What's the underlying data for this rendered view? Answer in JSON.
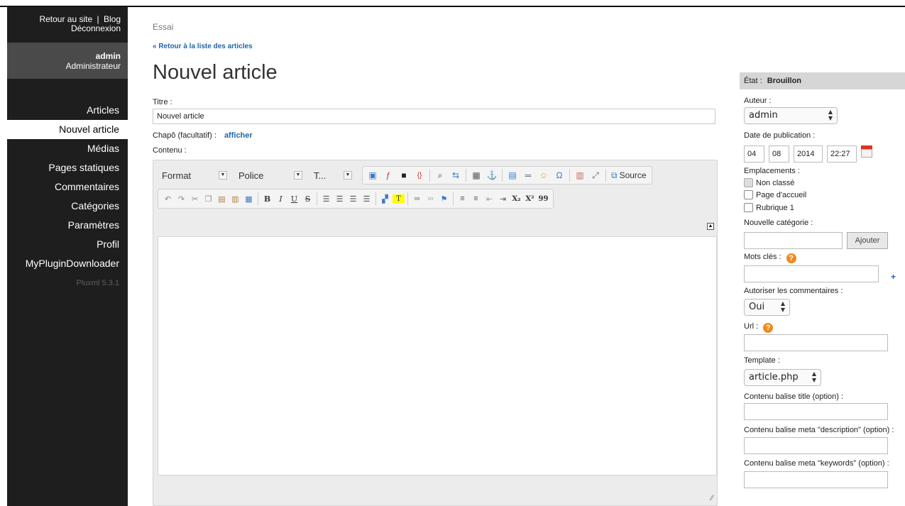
{
  "sidebar": {
    "top_links": [
      "Retour au site",
      "Blog",
      "Déconnexion"
    ],
    "separator": "|",
    "user_name": "admin",
    "user_role": "Administrateur",
    "menu": [
      "Articles",
      "Nouvel article",
      "Médias",
      "Pages statiques",
      "Commentaires",
      "Catégories",
      "Paramètres",
      "Profil",
      "MyPluginDownloader"
    ],
    "active_index": 1,
    "version": "Pluxml 5.3.1"
  },
  "main": {
    "site_name": "Essai",
    "back_link": "« Retour à la liste des articles",
    "page_title": "Nouvel article",
    "title_label": "Titre :",
    "title_value": "Nouvel article",
    "chapo_label": "Chapô (facultatif) :",
    "chapo_link": "afficher",
    "content_label": "Contenu :"
  },
  "editor": {
    "format_label": "Format",
    "font_label": "Police",
    "size_label": "T...",
    "source_label": "Source",
    "row1_icons": [
      "image-icon",
      "flash-icon",
      "camera-icon",
      "code-icon",
      "find-icon",
      "replace-icon",
      "table-icon",
      "anchor-icon",
      "templates-icon",
      "hr-icon",
      "smiley-icon",
      "omega-icon",
      "pagebreak-icon",
      "maximize-icon"
    ],
    "row2_icons": [
      "undo-icon",
      "redo-icon",
      "cut-icon",
      "copy-icon",
      "paste-icon",
      "paste-text-icon",
      "paste-word-icon"
    ],
    "format_buttons": [
      "B",
      "I",
      "U",
      "S"
    ],
    "align_icons": [
      "align-left-icon",
      "align-center-icon",
      "align-right-icon",
      "justify-icon"
    ],
    "color_icons": [
      "text-color-icon",
      "bg-color-icon"
    ],
    "link_icons": [
      "link-icon",
      "unlink-icon",
      "anchor-link-icon"
    ],
    "list_icons": [
      "numbered-list-icon",
      "bullet-list-icon",
      "outdent-icon",
      "indent-icon"
    ],
    "script_buttons": [
      "X₂",
      "X²",
      "99"
    ]
  },
  "panel": {
    "state_label": "État :",
    "state_value": "Brouillon",
    "author_label": "Auteur :",
    "author_value": "admin",
    "date_label": "Date de publication :",
    "date_day": "04",
    "date_month": "08",
    "date_year": "2014",
    "date_time": "22:27",
    "locations_label": "Emplacements :",
    "locations": [
      "Non classé",
      "Page d'accueil",
      "Rubrique 1"
    ],
    "new_category_label": "Nouvelle catégorie :",
    "add_button": "Ajouter",
    "tags_label": "Mots clés :",
    "plus": "+",
    "comments_label": "Autoriser les commentaires :",
    "comments_value": "Oui",
    "url_label": "Url :",
    "template_label": "Template :",
    "template_value": "article.php",
    "title_tag_label": "Contenu balise title (option) :",
    "meta_desc_label": "Contenu balise meta \"description\" (option) :",
    "meta_keywords_label": "Contenu balise meta \"keywords\" (option) :",
    "help_glyph": "?"
  },
  "colors": {
    "sidebar_bg": "#1e1e1e",
    "link": "#2266aa",
    "help": "#f08a1c"
  }
}
